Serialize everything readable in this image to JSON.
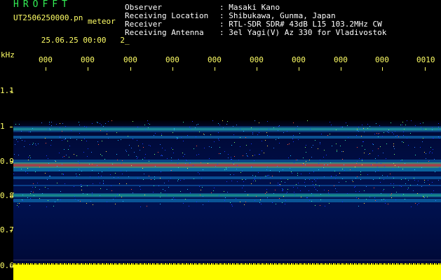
{
  "header": {
    "brand": "HROFFT",
    "file_name": "UT2506250000.pn",
    "meteor_label": "meteor",
    "time": "25.06.25 00:00",
    "count": "2_"
  },
  "info": [
    {
      "label": "Observer",
      "value": ": Masaki Kano"
    },
    {
      "label": "Receiving Location",
      "value": ": Shibukawa, Gunma, Japan"
    },
    {
      "label": "Receiver",
      "value": ": RTL-SDR SDR# 43dB L15 103.2MHz CW"
    },
    {
      "label": "Receiving Antenna",
      "value": ": 3el Yagi(V) Az 330 for Vladivostok"
    }
  ],
  "axis": {
    "unit": "kHz",
    "y_labels": [
      "1.1",
      "1",
      "0.9",
      "0.8",
      "0.7",
      "0.6"
    ],
    "x_labels": [
      "000",
      "000",
      "000",
      "000",
      "000",
      "000",
      "000",
      "000",
      "000",
      "0010"
    ]
  },
  "colors": {
    "label": "#ffff66",
    "brand": "#33ee55",
    "info": "#ffffff",
    "background": "#000000",
    "noise": "#0a1e8c",
    "hot": "#ff3333",
    "warm": "#33ff99",
    "strip": "#ffff00"
  }
}
